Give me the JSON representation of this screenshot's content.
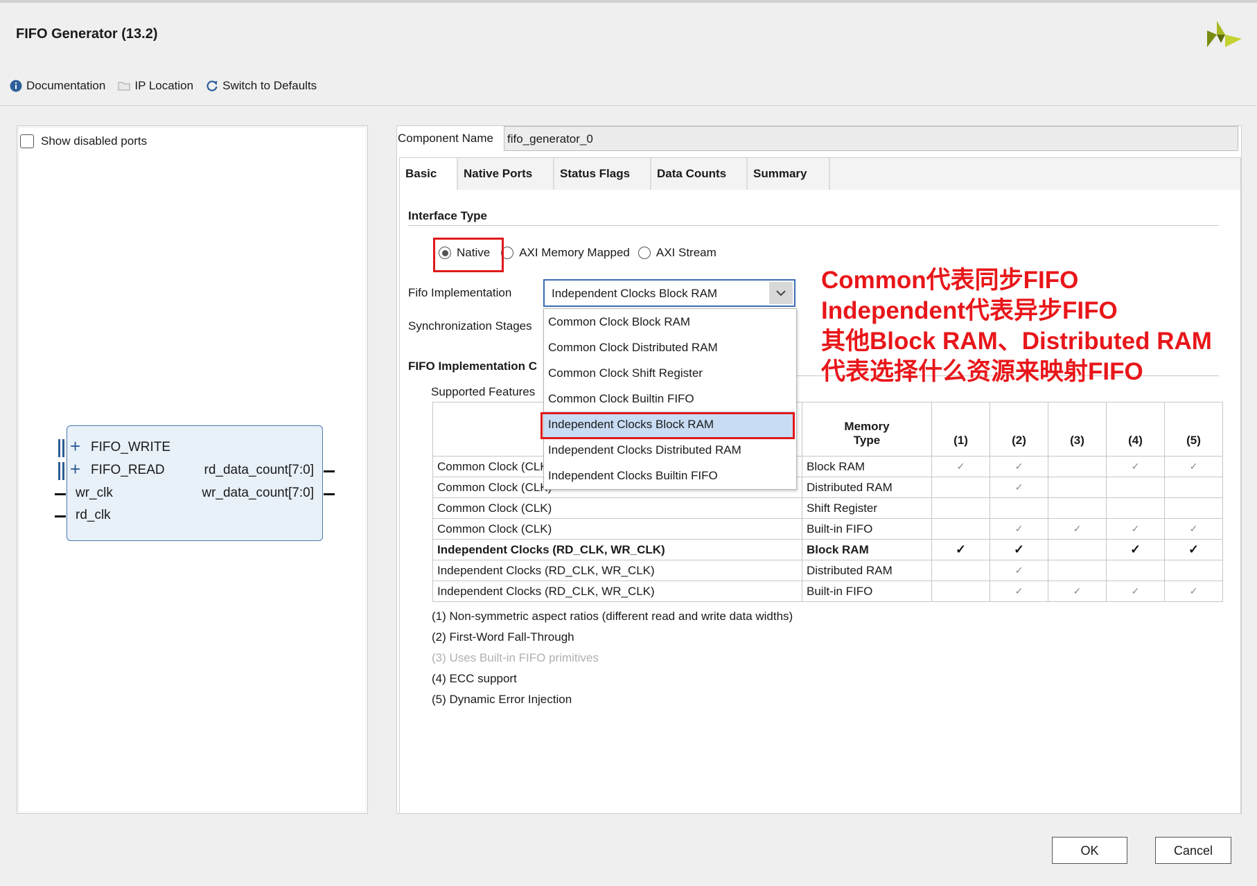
{
  "window": {
    "title": "FIFO Generator (13.2)"
  },
  "toolbar": {
    "documentation": "Documentation",
    "ip_location": "IP Location",
    "switch_defaults": "Switch to Defaults"
  },
  "left": {
    "show_disabled_ports": "Show disabled ports",
    "block": {
      "ports_left": [
        "FIFO_WRITE",
        "FIFO_READ",
        "wr_clk",
        "rd_clk"
      ],
      "ports_right": [
        "rd_data_count[7:0]",
        "wr_data_count[7:0]"
      ]
    }
  },
  "component": {
    "label": "Component Name",
    "value": "fifo_generator_0"
  },
  "tabs": [
    "Basic",
    "Native Ports",
    "Status Flags",
    "Data Counts",
    "Summary"
  ],
  "basic": {
    "interface_type_heading": "Interface Type",
    "interface_options": [
      "Native",
      "AXI Memory Mapped",
      "AXI Stream"
    ],
    "interface_selected": "Native",
    "fifo_impl_label": "Fifo Implementation",
    "fifo_impl_value": "Independent Clocks Block RAM",
    "sync_stages_label": "Synchronization Stages",
    "dropdown_options": [
      "Common Clock Block RAM",
      "Common Clock Distributed RAM",
      "Common Clock Shift Register",
      "Common Clock Builtin FIFO",
      "Independent Clocks Block RAM",
      "Independent Clocks Distributed RAM",
      "Independent Clocks Builtin FIFO"
    ],
    "impl_options_heading": "FIFO Implementation C",
    "supported_features": "Supported Features",
    "table": {
      "header_memory_1": "Memory",
      "header_memory_2": "Type",
      "header_cols": [
        "(1)",
        "(2)",
        "(3)",
        "(4)",
        "(5)"
      ],
      "rows": [
        {
          "clock": "Common Clock (CLK)",
          "memory": "Block RAM",
          "checks": [
            "✓",
            "✓",
            "",
            "✓",
            "✓"
          ]
        },
        {
          "clock": "Common Clock (CLK)",
          "memory": "Distributed RAM",
          "checks": [
            "",
            "✓",
            "",
            "",
            ""
          ]
        },
        {
          "clock": "Common Clock (CLK)",
          "memory": "Shift Register",
          "checks": [
            "",
            "",
            "",
            "",
            ""
          ]
        },
        {
          "clock": "Common Clock (CLK)",
          "memory": "Built-in FIFO",
          "checks": [
            "",
            "✓",
            "✓",
            "✓",
            "✓"
          ]
        },
        {
          "clock": "Independent Clocks (RD_CLK, WR_CLK)",
          "memory": "Block RAM",
          "checks": [
            "✓",
            "✓",
            "",
            "✓",
            "✓"
          ]
        },
        {
          "clock": "Independent Clocks (RD_CLK, WR_CLK)",
          "memory": "Distributed RAM",
          "checks": [
            "",
            "✓",
            "",
            "",
            ""
          ]
        },
        {
          "clock": "Independent Clocks (RD_CLK, WR_CLK)",
          "memory": "Built-in FIFO",
          "checks": [
            "",
            "✓",
            "✓",
            "✓",
            "✓"
          ]
        }
      ]
    },
    "notes": [
      "(1) Non-symmetric aspect ratios (different read and write data widths)",
      "(2) First-Word Fall-Through",
      "(3) Uses Built-in FIFO primitives",
      "(4) ECC support",
      "(5) Dynamic Error Injection"
    ]
  },
  "annotation": {
    "lines": [
      "Common代表同步FIFO",
      "Independent代表异步FIFO",
      "其他Block RAM、Distributed RAM",
      "代表选择什么资源来映射FIFO"
    ],
    "color": "#e8161a"
  },
  "buttons": {
    "ok": "OK",
    "cancel": "Cancel"
  }
}
